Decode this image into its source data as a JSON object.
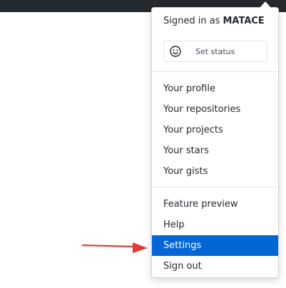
{
  "header": {
    "signed_in_prefix": "Signed in as",
    "username": "MATACE"
  },
  "status": {
    "label": "Set status",
    "icon": "smiley-icon"
  },
  "menu": {
    "group1": [
      "Your profile",
      "Your repositories",
      "Your projects",
      "Your stars",
      "Your gists"
    ],
    "group2": [
      "Feature preview",
      "Help",
      "Settings",
      "Sign out"
    ]
  },
  "active_item": "Settings",
  "colors": {
    "active_bg": "#0366d6",
    "topbar": "#24292e",
    "arrow": "#e53935"
  }
}
